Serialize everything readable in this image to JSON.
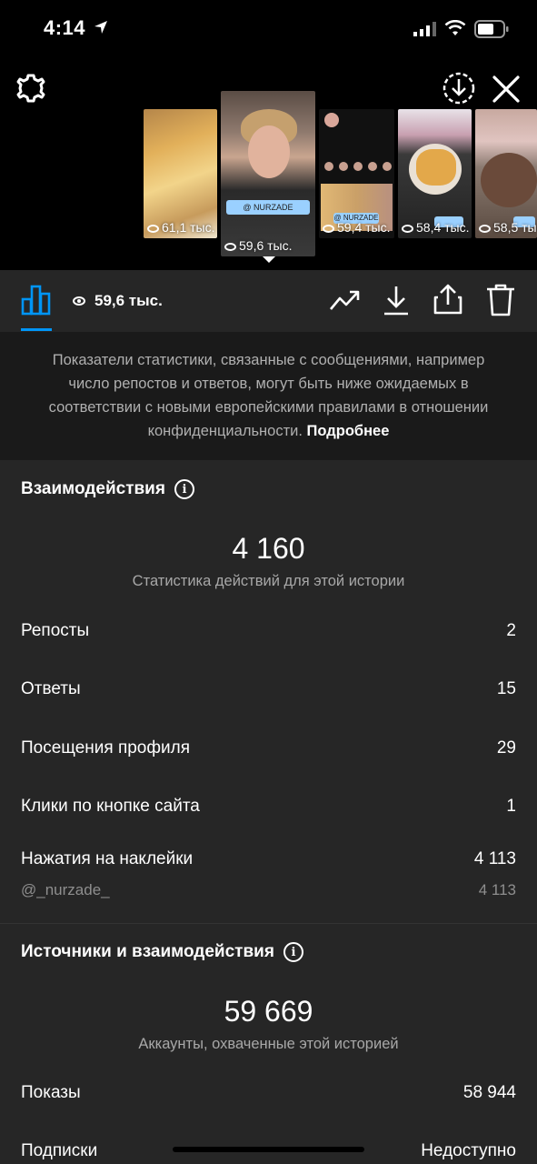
{
  "status_bar": {
    "time": "4:14"
  },
  "thumbnails": [
    {
      "views": "61,1 тыс."
    },
    {
      "views": "59,6 тыс."
    },
    {
      "views": "59,4 тыс."
    },
    {
      "views": "58,4 тыс."
    },
    {
      "views": "58,5 тыс."
    }
  ],
  "thumb_stickers": {
    "mention": "@ NURZADE"
  },
  "toolbar": {
    "views": "59,6 тыс."
  },
  "notice": {
    "text": "Показатели статистики, связанные с сообщениями, например число репостов и ответов, могут быть ниже ожидаемых в соответствии с новыми европейскими правилами в отношении конфиденциальности.",
    "link": "Подробнее"
  },
  "interactions": {
    "title": "Взаимодействия",
    "total": "4 160",
    "subtitle": "Статистика действий для этой истории",
    "rows": [
      {
        "label": "Репосты",
        "value": "2"
      },
      {
        "label": "Ответы",
        "value": "15"
      },
      {
        "label": "Посещения профиля",
        "value": "29"
      },
      {
        "label": "Клики по кнопке сайта",
        "value": "1"
      },
      {
        "label": "Нажатия на наклейки",
        "value": "4 113"
      }
    ],
    "sticker_sub": {
      "label": "@_nurzade_",
      "value": "4 113"
    }
  },
  "discovery": {
    "title": "Источники и взаимодействия",
    "total": "59 669",
    "subtitle": "Аккаунты, охваченные этой историей",
    "rows": [
      {
        "label": "Показы",
        "value": "58 944"
      },
      {
        "label": "Подписки",
        "value": "Недоступно"
      }
    ]
  },
  "info_glyph": "i",
  "colors": {
    "accent": "#0095f6",
    "panel": "#262626",
    "notice_bg": "#1a1a1a"
  }
}
